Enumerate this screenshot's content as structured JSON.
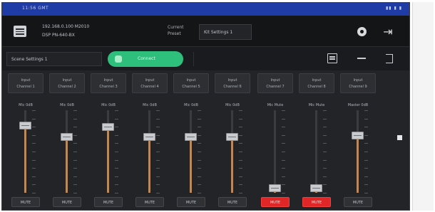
{
  "statusbar": {
    "time": "11:56  GMT",
    "icons": "▮▮ ▮ ▮"
  },
  "header": {
    "device_line1": "192.168.0.100 M2010",
    "device_line2": "DSP  PN-640-BX",
    "preset_label_1": "Current",
    "preset_label_2": "Preset",
    "preset_value": "Kit Settings 1"
  },
  "toolbar": {
    "scene": "Scene Settings 1",
    "connected_label": "Connect"
  },
  "channels": [
    {
      "name_1": "Input",
      "name_2": "Channel 1",
      "value": "Mic 0dB",
      "level": 0.82,
      "muted": false,
      "mute_label": "MUTE"
    },
    {
      "name_1": "Input",
      "name_2": "Channel 2",
      "value": "Mic 0dB",
      "level": 0.68,
      "muted": false,
      "mute_label": "MUTE"
    },
    {
      "name_1": "Input",
      "name_2": "Channel 3",
      "value": "Mic 0dB",
      "level": 0.8,
      "muted": false,
      "mute_label": "MUTE"
    },
    {
      "name_1": "Input",
      "name_2": "Channel 4",
      "value": "Mic 0dB",
      "level": 0.68,
      "muted": false,
      "mute_label": "MUTE"
    },
    {
      "name_1": "Input",
      "name_2": "Channel 5",
      "value": "Mic 0dB",
      "level": 0.68,
      "muted": false,
      "mute_label": "MUTE"
    },
    {
      "name_1": "Input",
      "name_2": "Channel 6",
      "value": "Mic 0dB",
      "level": 0.68,
      "muted": false,
      "mute_label": "MUTE"
    },
    {
      "name_1": "Input",
      "name_2": "Channel 7",
      "value": "Mic Mute",
      "level": 0.06,
      "muted": true,
      "mute_label": "MUTE"
    },
    {
      "name_1": "Input",
      "name_2": "Channel 8",
      "value": "Mic Mute",
      "level": 0.06,
      "muted": true,
      "mute_label": "MUTE"
    },
    {
      "name_1": "Input",
      "name_2": "Channel 9",
      "value": "Master 0dB",
      "level": 0.7,
      "muted": false,
      "mute_label": "MUTE"
    }
  ],
  "colors": {
    "accent_green": "#2fbf7c",
    "mute_red": "#e02626",
    "statusbar_blue": "#1f3ba6"
  }
}
